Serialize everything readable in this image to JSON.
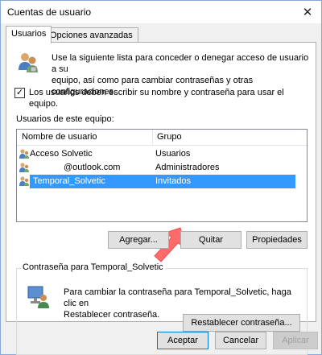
{
  "window": {
    "title": "Cuentas de usuario"
  },
  "tabs": [
    {
      "label": "Usuarios",
      "active": true
    },
    {
      "label": "Opciones avanzadas",
      "active": false
    }
  ],
  "intro": {
    "icon": "users-icon",
    "text_line1": "Use la siguiente lista para conceder o denegar acceso de usuario a su",
    "text_line2": "equipo, así como para cambiar contraseñas y otras configuraciones."
  },
  "require_login": {
    "checked": true,
    "label_line1": "Los usuarios deben escribir su nombre y contraseña para usar el",
    "label_line2": "equipo."
  },
  "users_list": {
    "caption": "Usuarios de este equipo:",
    "columns": [
      "Nombre de usuario",
      "Grupo"
    ],
    "rows": [
      {
        "name": "Acceso Solvetic",
        "group": "Usuarios",
        "selected": false
      },
      {
        "name": "@outlook.com",
        "group": "Administradores",
        "selected": false
      },
      {
        "name": "Temporal_Solvetic",
        "group": "Invitados",
        "selected": true
      }
    ]
  },
  "list_buttons": {
    "add": "Agregar...",
    "remove": "Quitar",
    "properties": "Propiedades"
  },
  "password_group": {
    "title": "Contraseña para Temporal_Solvetic",
    "text_line1": "Para cambiar la contraseña para Temporal_Solvetic, haga clic en",
    "text_line2": "Restablecer contraseña.",
    "reset_button": "Restablecer contraseña..."
  },
  "dialog_buttons": {
    "ok": "Aceptar",
    "cancel": "Cancelar",
    "apply": "Aplicar"
  },
  "colors": {
    "selection": "#3399ff",
    "highlight_arrow": "#ff6b6b",
    "default_button_border": "#0078d7"
  }
}
